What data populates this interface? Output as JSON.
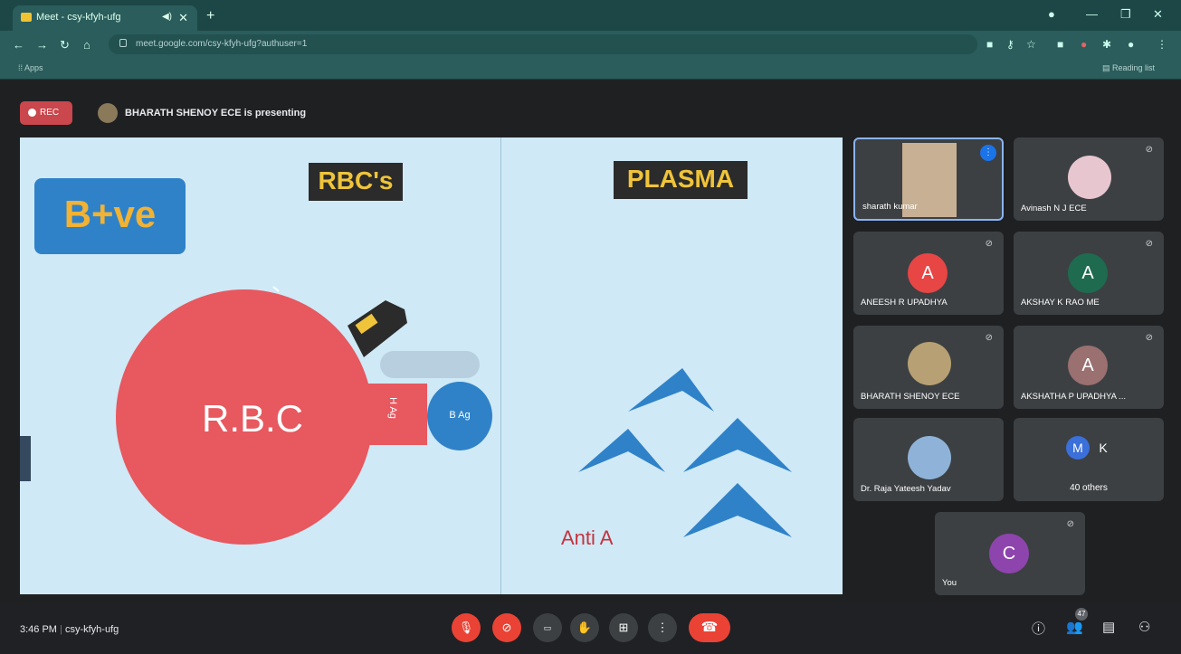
{
  "browser": {
    "tab_title": "Meet - csy-kfyh-ufg",
    "new_tab": "+",
    "url": "meet.google.com/csy-kfyh-ufg?authuser=1",
    "bookmarks": {
      "apps": "Apps",
      "reading_list": "Reading list"
    }
  },
  "meet": {
    "rec_label": "REC",
    "presenting_text": "BHARATH SHENOY ECE is presenting",
    "meeting_time": "3:46 PM",
    "meeting_code": "csy-kfyh-ufg",
    "participant_count_badge": "47"
  },
  "slide": {
    "rbc_heading": "RBC's",
    "plasma_heading": "PLASMA",
    "blood_group": "B+ve",
    "rbc_label": "R.B.C",
    "receptor_label": "H Ag",
    "antigen_label": "B Ag",
    "antibody_label": "Anti  A",
    "colors": {
      "background": "#cfe9f6",
      "rbc": "#e7585f",
      "antigen": "#2f82c8",
      "heading_text": "#f0c43a"
    }
  },
  "participants": [
    {
      "name": "sharath kumar",
      "type": "video",
      "speaking": true
    },
    {
      "name": "Avinash N J ECE",
      "type": "photo",
      "muted": true
    },
    {
      "name": "ANEESH R UPADHYA",
      "initial": "A",
      "color": "#e84545",
      "muted": true
    },
    {
      "name": "AKSHAY K RAO ME",
      "initial": "A",
      "color": "#1e6b4f",
      "muted": true
    },
    {
      "name": "BHARATH SHENOY ECE",
      "type": "photo",
      "muted": true
    },
    {
      "name": "AKSHATHA P UPADHYA ...",
      "initial": "A",
      "color": "#9a7070",
      "muted": true
    },
    {
      "name": "Dr. Raja Yateesh Yadav",
      "type": "photo"
    },
    {
      "others_initials": [
        "M",
        "K"
      ],
      "others_label": "40 others"
    },
    {
      "name": "You",
      "initial": "C",
      "color": "#8e44ad",
      "muted": true
    }
  ]
}
